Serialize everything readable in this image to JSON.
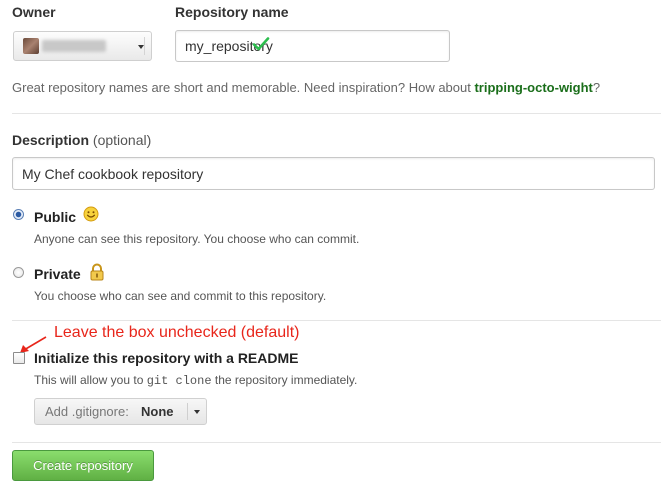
{
  "owner": {
    "label": "Owner"
  },
  "repository": {
    "label": "Repository name",
    "value": "my_repository",
    "hint_prefix": "Great repository names are short and memorable. Need inspiration? How about ",
    "suggestion": "tripping-octo-wight",
    "hint_suffix": "?"
  },
  "description": {
    "label": "Description",
    "optional": "(optional)",
    "value": "My Chef cookbook repository"
  },
  "visibility": {
    "public": {
      "title": "Public",
      "desc": "Anyone can see this repository. You choose who can commit.",
      "checked": true
    },
    "private": {
      "title": "Private",
      "desc": "You choose who can see and commit to this repository.",
      "checked": false
    }
  },
  "annotation": "Leave the box unchecked (default)",
  "readme": {
    "label": "Initialize this repository with a README",
    "desc_prefix": "This will allow you to",
    "desc_code": "git clone",
    "desc_suffix": "the repository immediately.",
    "checked": false
  },
  "gitignore": {
    "prefix": "Add .gitignore:",
    "value": "None"
  },
  "create_button": "Create repository",
  "colors": {
    "accent_green": "#60b044",
    "suggestion_green": "#1a6e1a",
    "check_green": "#2cbe4e",
    "annotation_red": "#e8261b"
  }
}
